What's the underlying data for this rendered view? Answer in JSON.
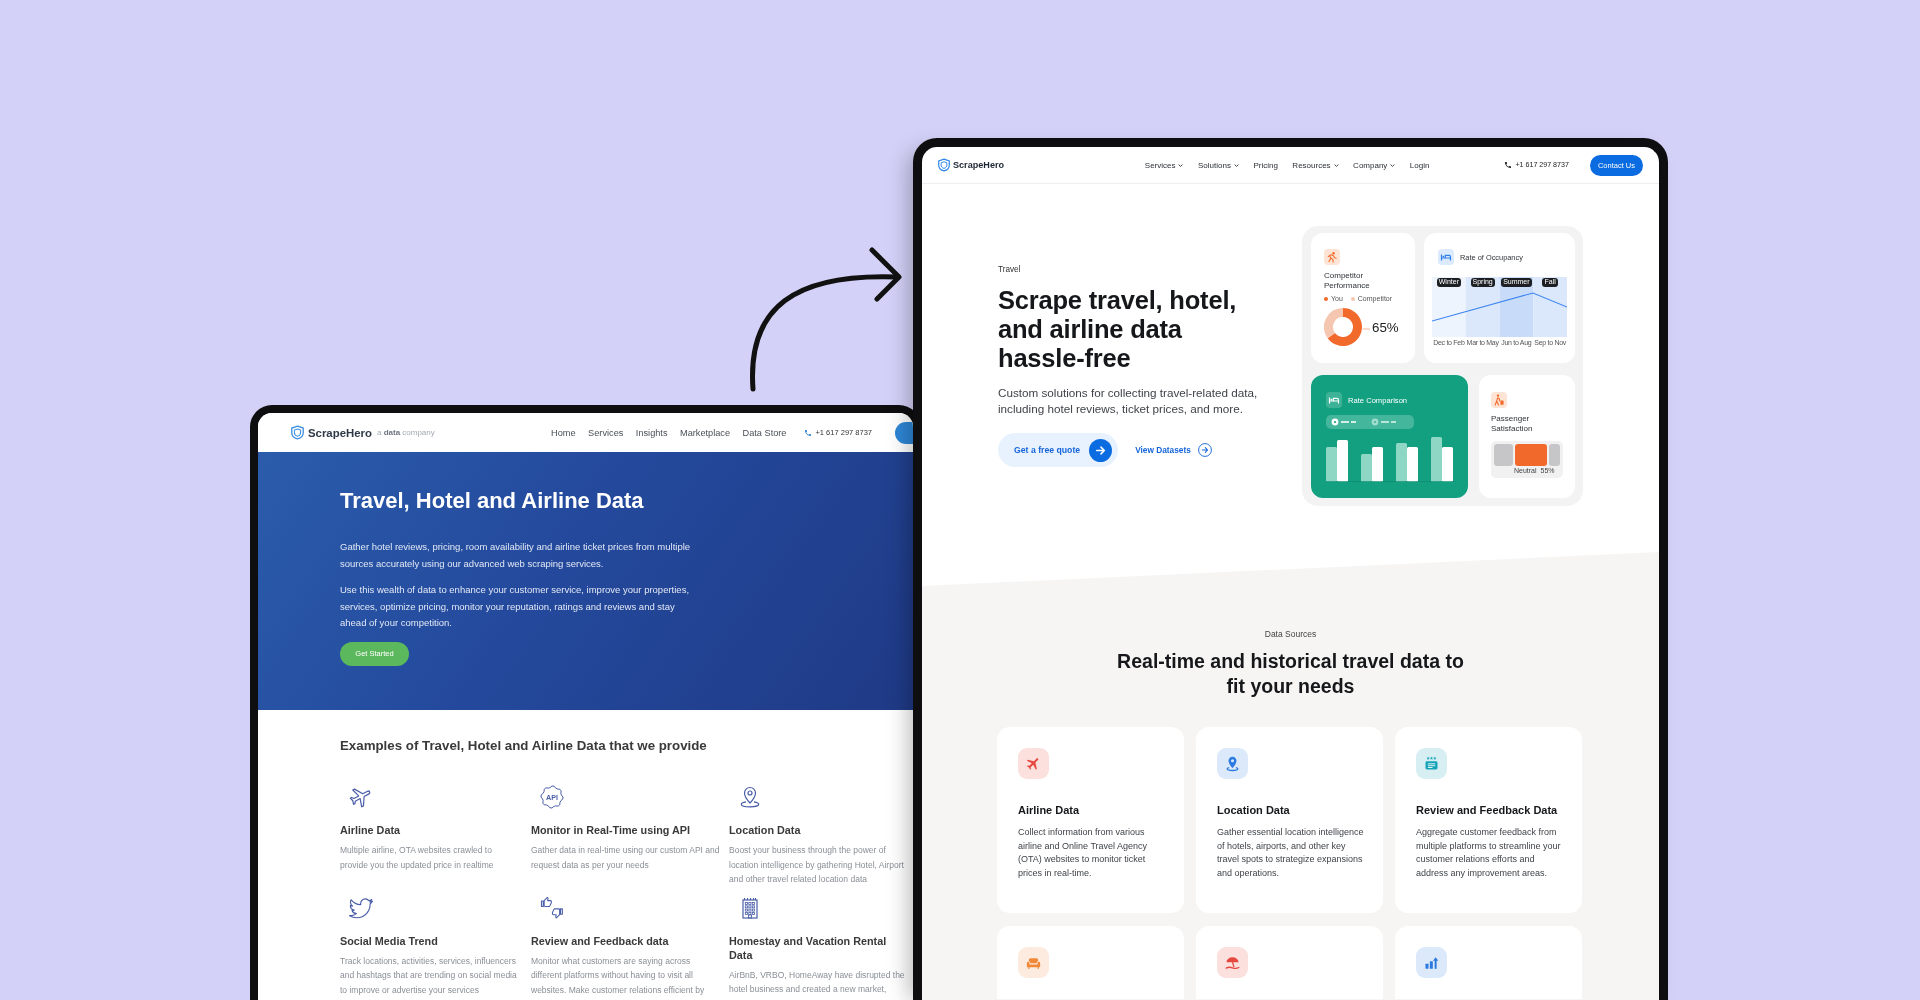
{
  "old_site": {
    "nav": {
      "logo": "ScrapeHero",
      "tagline": "a **data** company",
      "links": [
        "Home",
        "Services",
        "Insights",
        "Marketplace",
        "Data Store"
      ],
      "phone": "+1 617 297 8737"
    },
    "hero": {
      "title": "Travel, Hotel and Airline Data",
      "paragraphs": [
        "Gather hotel reviews, pricing, room availability and airline ticket prices from multiple sources accurately using our advanced web scraping services.",
        "Use this wealth of data to enhance your customer service, improve your properties, services, optimize pricing, monitor your reputation, ratings and reviews and stay ahead of your competition."
      ],
      "button": "Get Started"
    },
    "examples": {
      "title": "Examples of Travel, Hotel and Airline Data that we provide",
      "items": [
        {
          "title": "Airline Data",
          "text": "Multiple airline, OTA websites crawled to provide you the updated price in realtime"
        },
        {
          "title": "Monitor in Real-Time using API",
          "badge": "API",
          "text": "Gather data in real-time using our custom API and request data as per your needs"
        },
        {
          "title": "Location Data",
          "text": "Boost your business through the power of location intelligence by gathering Hotel, Airport and other travel related location data"
        },
        {
          "title": "Social Media Trend",
          "text": "Track locations, activities, services, influencers and hashtags that are trending on social media to improve or advertise your services"
        },
        {
          "title": "Review and Feedback data",
          "text": "Monitor what customers are saying across different platforms without having to visit all websites. Make customer relations efficient by"
        },
        {
          "title": "Homestay and Vacation Rental Data",
          "text": "AirBnB, VRBO, HomeAway have disrupted the hotel business and created a new market,"
        }
      ]
    }
  },
  "new_site": {
    "nav": {
      "logo": "ScrapeHero",
      "links": [
        {
          "label": "Services",
          "dropdown": true
        },
        {
          "label": "Solutions",
          "dropdown": true
        },
        {
          "label": "Pricing",
          "dropdown": false
        },
        {
          "label": "Resources",
          "dropdown": true
        },
        {
          "label": "Company",
          "dropdown": true
        },
        {
          "label": "Login",
          "dropdown": false
        }
      ],
      "phone": "+1 617 297 8737",
      "button": "Contact Us"
    },
    "hero": {
      "eyebrow": "Travel",
      "title": "Scrape travel, hotel, and airline data hassle-free",
      "text": "Custom solutions for collecting travel-related data, including hotel reviews, ticket prices, and more.",
      "primary_button": "Get a free quote",
      "secondary_link": "View Datasets"
    },
    "widgets": {
      "competitor": {
        "title": "Competitor Performance",
        "legend": [
          {
            "color": "#f26a2b"
          },
          {
            "color": "#f6c7b0"
          }
        ],
        "reading": "65%",
        "chart_data": {
          "type": "donut",
          "categories": [
            "You",
            "Competitor"
          ],
          "values": [
            65,
            35
          ]
        }
      },
      "occupancy": {
        "title": "Rate of Occupancy",
        "seasons": [
          "Winter",
          "Spring",
          "Summer",
          "Fall"
        ],
        "periods": [
          "Dec to Feb",
          "Mar to May",
          "Jun to Aug",
          "Sep to Nov"
        ]
      },
      "rate_comparison": {
        "title": "Rate Comparison"
      },
      "satisfaction": {
        "title": "Passenger Satisfaction",
        "labels": [
          "Neutral",
          "55%"
        ]
      }
    },
    "data_sources": {
      "eyebrow": "Data Sources",
      "title": "Real-time and historical travel data to fit your needs",
      "cards": [
        {
          "title": "Airline Data",
          "text": "Collect information from various airline and Online Travel Agency (OTA) websites to monitor ticket prices in real-time.",
          "color": "#e5483f"
        },
        {
          "title": "Location Data",
          "text": "Gather essential location intelligence of hotels, airports, and other key travel spots to strategize expansions and operations.",
          "color": "#2d7be0"
        },
        {
          "title": "Review and Feedback Data",
          "text": "Aggregate customer feedback from multiple platforms to streamline your customer relations efforts and address any improvement areas.",
          "color": "#15a3b8"
        },
        {
          "color": "#f08a3a"
        },
        {
          "color": "#e5483f"
        },
        {
          "color": "#2d7be0"
        }
      ]
    }
  }
}
